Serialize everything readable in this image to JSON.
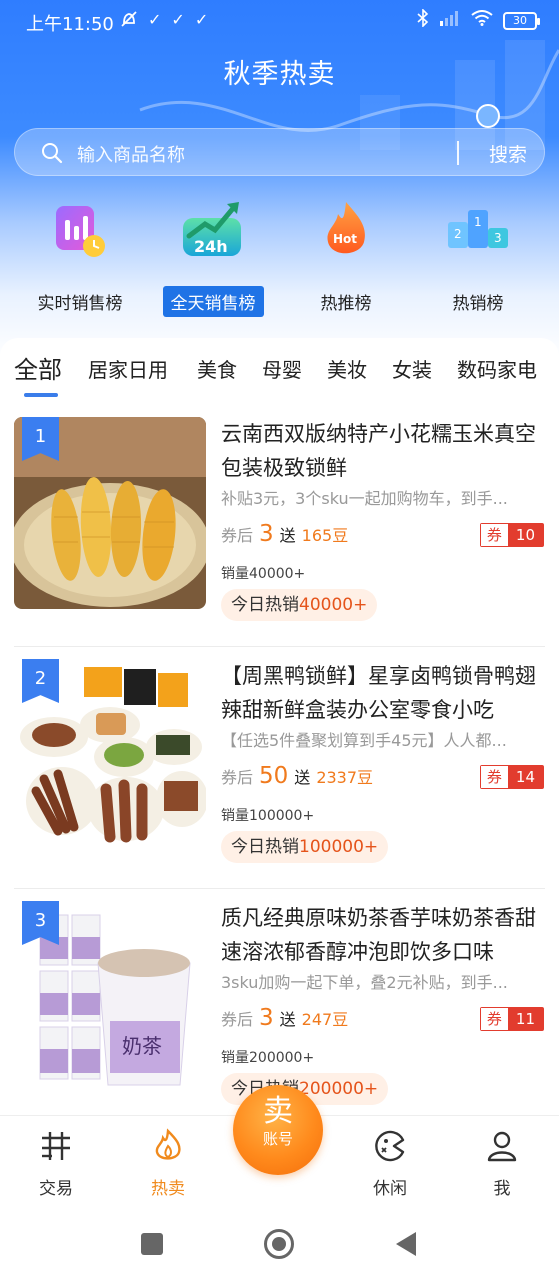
{
  "status_bar": {
    "time": "上午11:50",
    "battery": "30"
  },
  "header": {
    "title": "秋季热卖"
  },
  "search": {
    "placeholder": "输入商品名称",
    "button": "搜索"
  },
  "categories": [
    {
      "label": "实时销售榜",
      "icon": "realtime-chart-icon",
      "active": false
    },
    {
      "label": "全天销售榜",
      "icon": "24h-trend-icon",
      "active": true
    },
    {
      "label": "热推榜",
      "icon": "hot-flame-icon",
      "active": false
    },
    {
      "label": "热销榜",
      "icon": "podium-icon",
      "active": false
    }
  ],
  "tabs": [
    {
      "label": "全部",
      "active": true
    },
    {
      "label": "居家日用"
    },
    {
      "label": "美食"
    },
    {
      "label": "母婴"
    },
    {
      "label": "美妆"
    },
    {
      "label": "女装"
    },
    {
      "label": "数码家电"
    }
  ],
  "products": [
    {
      "rank": "1",
      "title": "云南西双版纳特产小花糯玉米真空包装极致锁鲜",
      "subtitle": "补贴3元，3个sku一起加购物车，到手...",
      "price_prefix": "券后",
      "price": "3",
      "gift_prefix": "送",
      "beans": "165豆",
      "coupon_label": "券",
      "coupon_value": "10",
      "sales": "销量40000+",
      "hot_prefix": "今日热销",
      "hot_value": "40000+"
    },
    {
      "rank": "2",
      "title": "【周黑鸭锁鲜】星享卤鸭锁骨鸭翅辣甜新鲜盒装办公室零食小吃",
      "subtitle": "【任选5件叠聚划算到手45元】人人都...",
      "price_prefix": "券后",
      "price": "50",
      "gift_prefix": "送",
      "beans": "2337豆",
      "coupon_label": "券",
      "coupon_value": "14",
      "sales": "销量100000+",
      "hot_prefix": "今日热销",
      "hot_value": "100000+"
    },
    {
      "rank": "3",
      "title": "质凡经典原味奶茶香芋味奶茶香甜速溶浓郁香醇冲泡即饮多口味",
      "subtitle": "3sku加购一起下单，叠2元补贴，到手...",
      "price_prefix": "券后",
      "price": "3",
      "gift_prefix": "送",
      "beans": "247豆",
      "coupon_label": "券",
      "coupon_value": "11",
      "sales": "销量200000+",
      "hot_prefix": "今日热销",
      "hot_value": "200000+",
      "image_text": "奶茶"
    }
  ],
  "bottom_nav": {
    "trade": "交易",
    "hot": "热卖",
    "sell_main": "卖",
    "sell_sub": "账号",
    "leisure": "休闲",
    "me": "我"
  },
  "colors": {
    "accent_blue": "#2f7dff",
    "accent_orange": "#f08a1d",
    "coupon_red": "#e23c2e"
  }
}
